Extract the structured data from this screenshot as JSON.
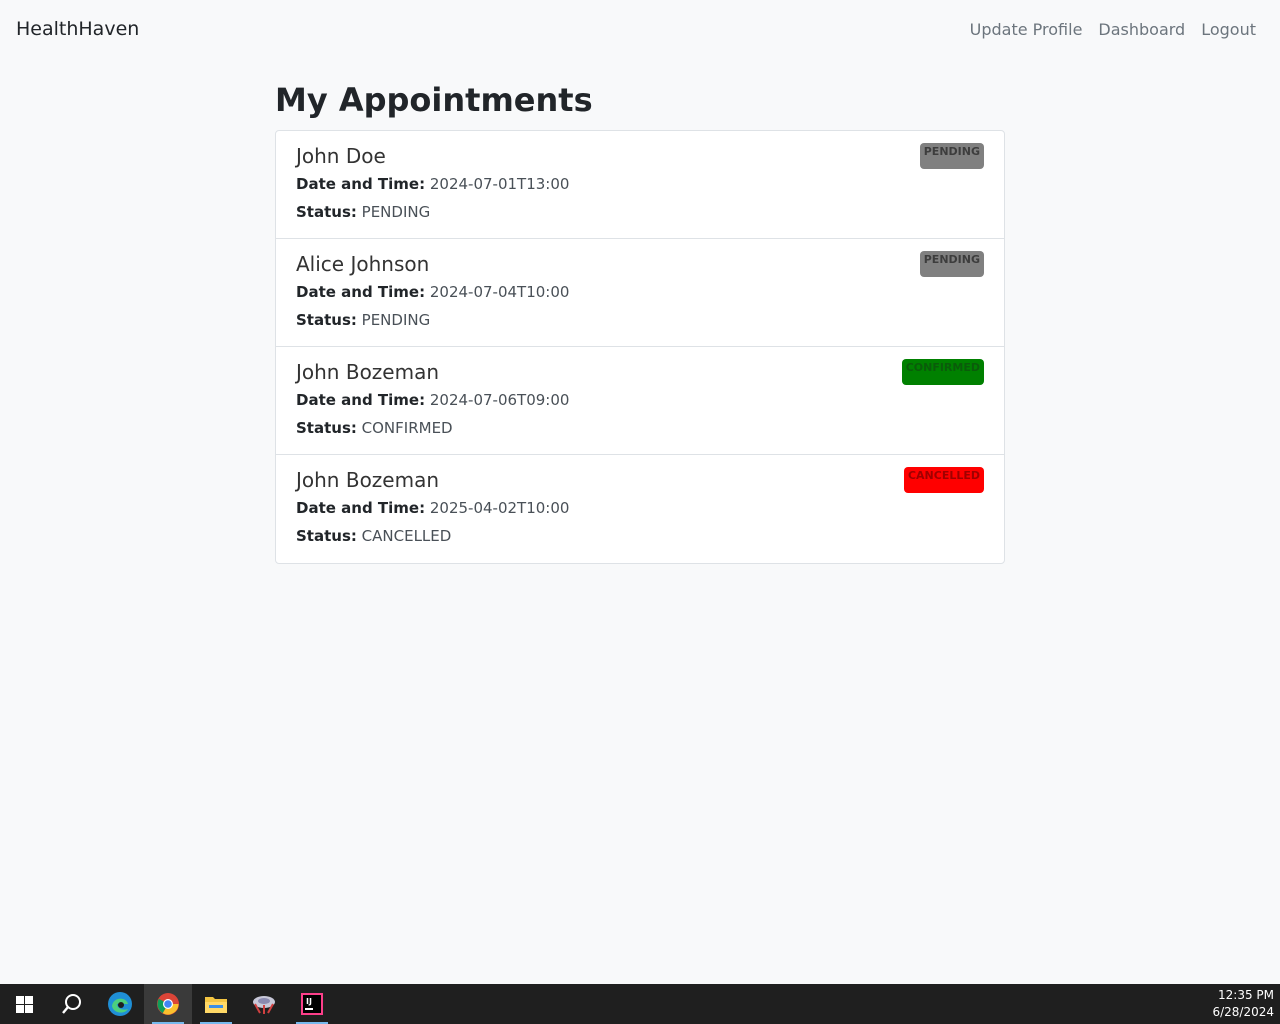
{
  "nav": {
    "brand": "HealthHaven",
    "links": [
      "Update Profile",
      "Dashboard",
      "Logout"
    ]
  },
  "page": {
    "title": "My Appointments"
  },
  "labels": {
    "datetime": "Date and Time:",
    "status": "Status:"
  },
  "appointments": [
    {
      "name": "John Doe",
      "datetime": "2024-07-01T13:00",
      "status": "PENDING",
      "badge": "PENDING",
      "badge_bg": "#808080",
      "badge_fg": "#3d3d3d"
    },
    {
      "name": "Alice Johnson",
      "datetime": "2024-07-04T10:00",
      "status": "PENDING",
      "badge": "PENDING",
      "badge_bg": "#808080",
      "badge_fg": "#3d3d3d"
    },
    {
      "name": "John Bozeman",
      "datetime": "2024-07-06T09:00",
      "status": "CONFIRMED",
      "badge": "CONFIRMED",
      "badge_bg": "#008000",
      "badge_fg": "#0a5c0a"
    },
    {
      "name": "John Bozeman",
      "datetime": "2025-04-02T10:00",
      "status": "CANCELLED",
      "badge": "CANCELLED",
      "badge_bg": "#ff0000",
      "badge_fg": "#a00000"
    }
  ],
  "taskbar": {
    "icons": [
      "windows-start-icon",
      "search-icon",
      "edge-icon",
      "chrome-icon",
      "file-explorer-icon",
      "app-icon",
      "intellij-icon"
    ],
    "time": "12:35 PM",
    "date": "6/28/2024"
  }
}
